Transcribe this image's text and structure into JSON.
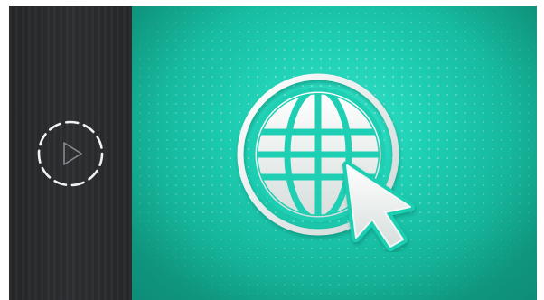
{
  "player": {
    "play_icon": "play-icon",
    "globe_icon": "globe-icon",
    "cursor_icon": "cursor-pointer-icon"
  },
  "colors": {
    "sidebar": "#2b2c2f",
    "accent": "#1fcfb3",
    "icon": "#eef2f1"
  }
}
